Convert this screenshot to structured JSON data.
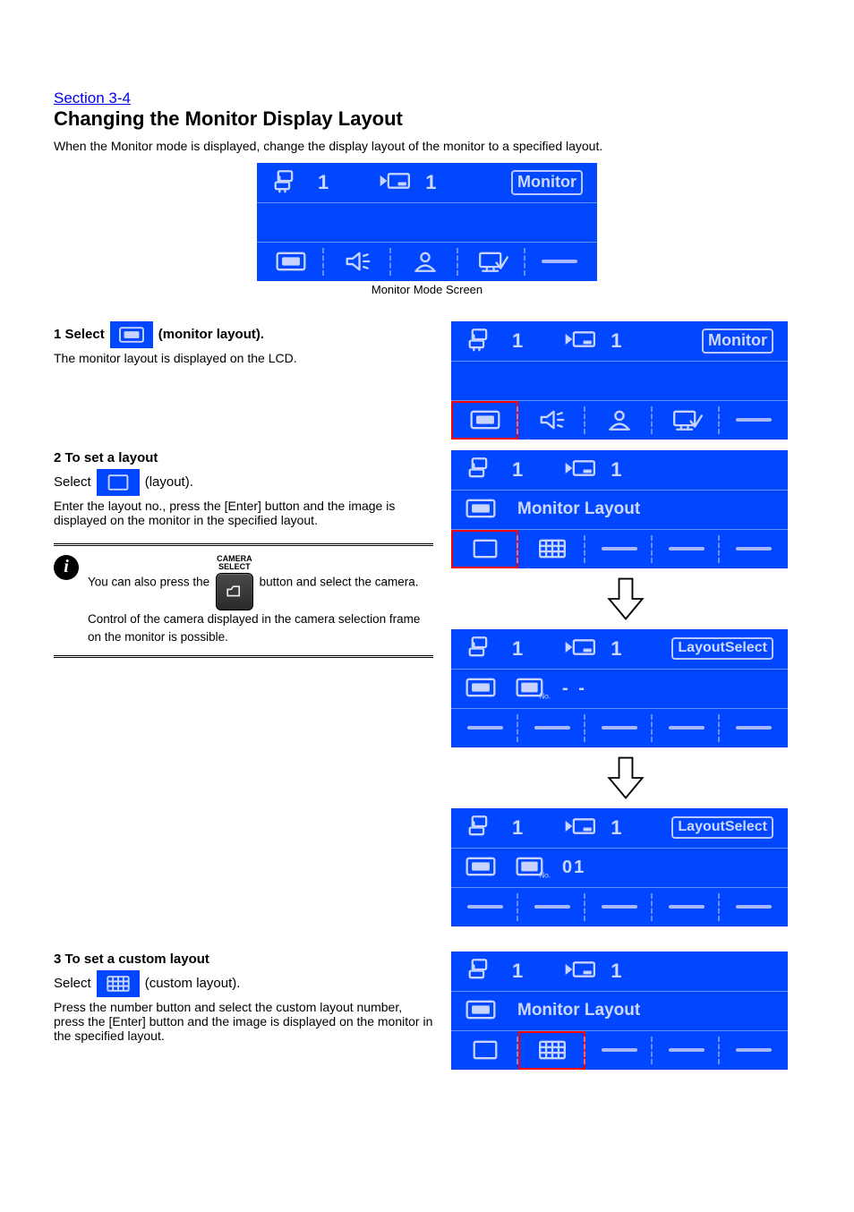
{
  "section_link": "Section 3-4",
  "title": "Changing the Monitor Display Layout",
  "intro": "When the Monitor mode is displayed, change the display layout of the monitor to a specified layout.",
  "main_caption": "Monitor Mode Screen",
  "step1": {
    "line": "1  Select",
    "after": "(monitor layout).",
    "body": "The monitor layout is displayed on the LCD."
  },
  "step2": {
    "heading": "2  To set a layout",
    "select_line": {
      "pre": "Select",
      "post": "(layout)."
    },
    "body": "Enter the layout no., press the [Enter] button and the image is displayed on the monitor in the specified layout."
  },
  "info": {
    "text_before": "You can also press the",
    "btn_top": "CAMERA",
    "btn_bottom": "SELECT",
    "text_mid": "button and select the camera. Control of the camera displayed in the camera selection frame on the monitor",
    "text_after": "is possible."
  },
  "step3": {
    "heading": "3  To set a custom layout",
    "select_line": {
      "pre": "Select",
      "post": "(custom layout)."
    },
    "body": "Press the number button and select the custom layout number, press the [Enter] button and the image is displayed on the monitor in the specified layout."
  },
  "lcd": {
    "monitor_badge": "Monitor",
    "layout_select_badge": "LayoutSelect",
    "one": "1",
    "layout_label": "Monitor Layout",
    "dashes": "- -",
    "layout_no": "01"
  }
}
